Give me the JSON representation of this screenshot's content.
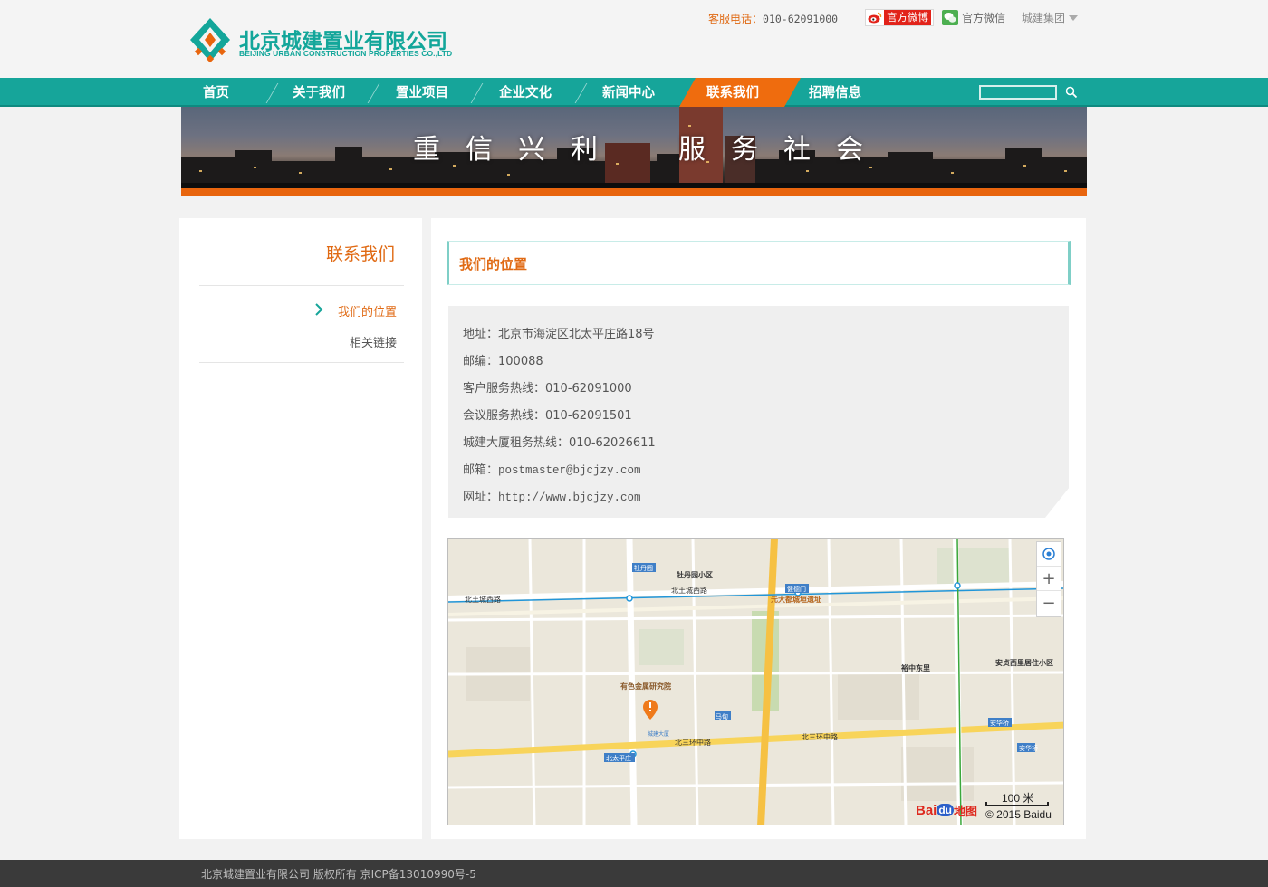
{
  "header": {
    "logo_cn": "北京城建置业有限公司",
    "logo_en": "BEIJING URBAN CONSTRUCTION PROPERTIES CO.,LTD",
    "hotline_label": "客服电话：",
    "hotline_number": "010-62091000",
    "weibo_label": "官方微博",
    "wechat_label": "官方微信",
    "group_label": "城建集团"
  },
  "nav": {
    "items": [
      "首页",
      "关于我们",
      "置业项目",
      "企业文化",
      "新闻中心",
      "联系我们",
      "招聘信息"
    ],
    "active": "联系我们",
    "search_placeholder": ""
  },
  "banner": {
    "slogan_left": "重信兴利",
    "slogan_right": "服务社会"
  },
  "sidebar": {
    "title": "联系我们",
    "items": [
      "我们的位置",
      "相关链接"
    ]
  },
  "main": {
    "section_title": "我们的位置",
    "info": {
      "address_label": "地址：",
      "address": "北京市海淀区北太平庄路18号",
      "zip_label": "邮编：",
      "zip": "100088",
      "service_label": "客户服务热线：",
      "service": "010-62091000",
      "meeting_label": "会议服务热线：",
      "meeting": "010-62091501",
      "rent_label": "城建大厦租务热线：",
      "rent": "010-62026611",
      "email_label": "邮箱：",
      "email": "postmaster@bjcjzy.com",
      "web_label": "网址：",
      "web": "http://www.bjcjzy.com"
    }
  },
  "map": {
    "scale_label": "100 米",
    "copyright": "© 2015 Baidu",
    "logo_bai": "Bai",
    "logo_du": "du",
    "logo_map": "地图",
    "labels": {
      "north_3rd": "北三环中路",
      "north_3rd_e": "北三环中路",
      "beitaipingzhuang": "北太平庄",
      "mudanyuan": "牡丹园",
      "jiandemen": "健德门",
      "yuandadu": "元大都城垣遗址",
      "mudanyuan_xq": "牡丹园小区",
      "youse": "有色金属研究院",
      "bei_tu_cheng_w": "北土城西路",
      "bei_tu_cheng_w2": "北土城西路",
      "yuzhong": "裕中东里",
      "anzhen": "安贞西里居住小区",
      "chengjian": "城建大厦",
      "mapu": "马甸",
      "anhua": "安华桥",
      "anhua_station": "安华桥"
    }
  }
}
